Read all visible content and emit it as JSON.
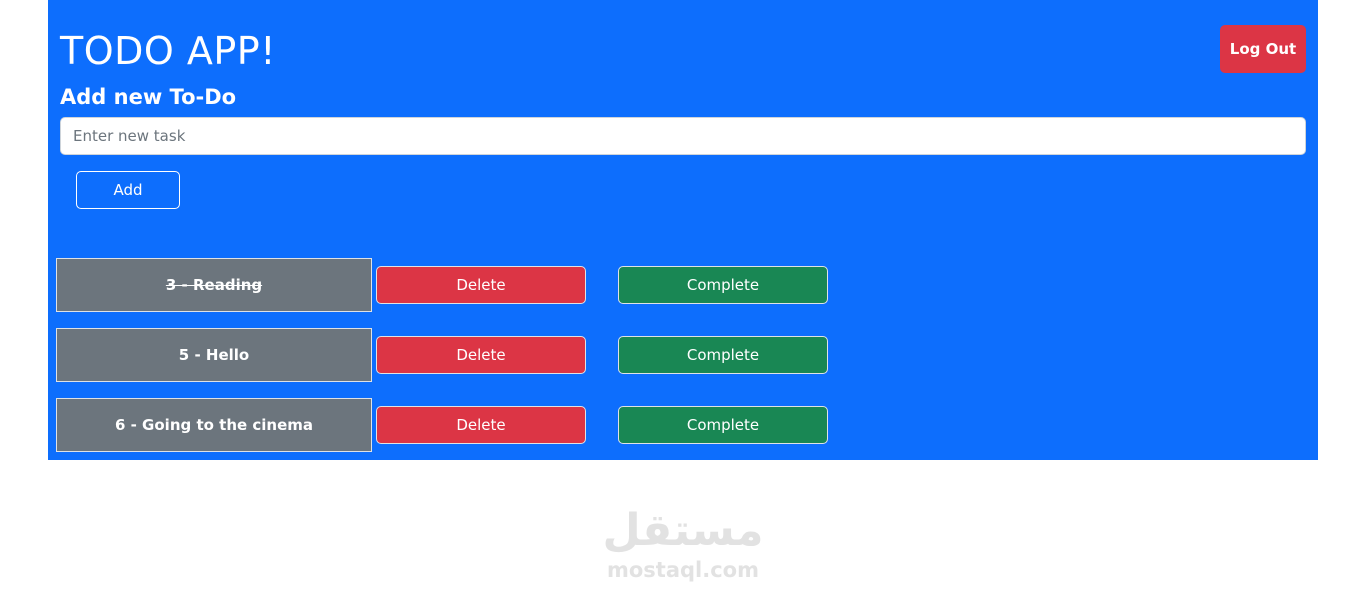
{
  "header": {
    "title": "TODO APP!",
    "logout_label": "Log Out"
  },
  "form": {
    "heading": "Add new To-Do",
    "input_placeholder": "Enter new task",
    "input_value": "",
    "add_label": "Add"
  },
  "todos": [
    {
      "label": "3 - Reading",
      "completed": true,
      "delete_label": "Delete",
      "complete_label": "Complete"
    },
    {
      "label": "5 - Hello",
      "completed": false,
      "delete_label": "Delete",
      "complete_label": "Complete"
    },
    {
      "label": "6 - Going to the cinema",
      "completed": false,
      "delete_label": "Delete",
      "complete_label": "Complete"
    }
  ],
  "watermark": {
    "arabic": "مستقل",
    "latin": "mostaql.com"
  },
  "colors": {
    "background": "#0d6efd",
    "danger": "#dc3545",
    "success": "#198754",
    "secondary": "#6c757d"
  }
}
